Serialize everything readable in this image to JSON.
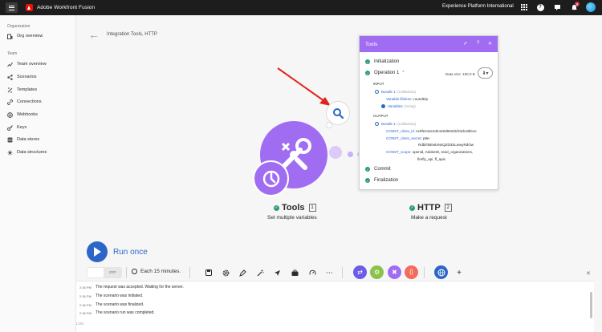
{
  "topbar": {
    "app_title": "Adobe Workfront Fusion",
    "org_name": "Experience Platform International",
    "notification_count": "9",
    "icons": [
      "menu-icon",
      "adobe-logo",
      "apps-grid-icon",
      "help-icon",
      "announcement-icon",
      "bell-icon",
      "avatar"
    ]
  },
  "sidebar": {
    "org_section": "Organization",
    "team_section": "Team",
    "items": [
      {
        "label": "Org overview",
        "icon": "org-icon"
      },
      {
        "label": "Team overview",
        "icon": "chart-icon"
      },
      {
        "label": "Scenarios",
        "icon": "share-icon"
      },
      {
        "label": "Templates",
        "icon": "template-icon"
      },
      {
        "label": "Connections",
        "icon": "link-icon"
      },
      {
        "label": "Webhooks",
        "icon": "globe-icon"
      },
      {
        "label": "Keys",
        "icon": "key-icon"
      },
      {
        "label": "Data stores",
        "icon": "database-icon"
      },
      {
        "label": "Data structures",
        "icon": "structure-icon"
      }
    ]
  },
  "canvas": {
    "breadcrumb": "Integration Tools, HTTP",
    "modules": [
      {
        "name": "Tools",
        "count": "1",
        "subtitle": "Set multiple variables",
        "color": "#a06df2"
      },
      {
        "name": "HTTP",
        "count": "2",
        "subtitle": "Make a request"
      }
    ]
  },
  "panel": {
    "title": "Tools",
    "initialization": "Initialization",
    "operation": "Operation 1",
    "data_size": "Data size: 190.0 B",
    "input_label": "INPUT",
    "input_bundle": "Bundle 1:",
    "input_bundle_type": "(Collection)",
    "variable_lifetime_key": "Variable lifetime:",
    "variable_lifetime_value": "roundtrip",
    "variables_key": "Variables:",
    "variables_type": "(Array)",
    "output_label": "OUTPUT",
    "output_bundle": "Bundle 1:",
    "output_bundle_type": "(Collection)",
    "client_id_key": "CONST_client_id:",
    "client_id_value": "ec9fe216c2d4445d902d1f23dc36fece",
    "client_secret_key": "CONST_client_secret:",
    "client_secret_value_1": "p8e-",
    "client_secret_value_2": "Rdbl/rBEwtsNsQZD3SLwwyRdOw",
    "scope_key": "CONST_scope:",
    "scope_value_1": "openid, AdobeID, read_organizations,",
    "scope_value_2": "firefly_api, ff_apis",
    "commit": "Commit",
    "finalization": "Finalization"
  },
  "run": {
    "label": "Run once",
    "toggle": "OFF",
    "schedule": "Each 15 minutes."
  },
  "log": {
    "label": "LOG",
    "rows": [
      {
        "time": "2:36 PM",
        "text": "The request was accepted. Waiting for the server."
      },
      {
        "time": "2:36 PM",
        "text": "The scenario was initiated."
      },
      {
        "time": "2:36 PM",
        "text": "The scenario was finalized."
      },
      {
        "time": "2:36 PM",
        "text": "The scenario run was completed."
      }
    ]
  }
}
